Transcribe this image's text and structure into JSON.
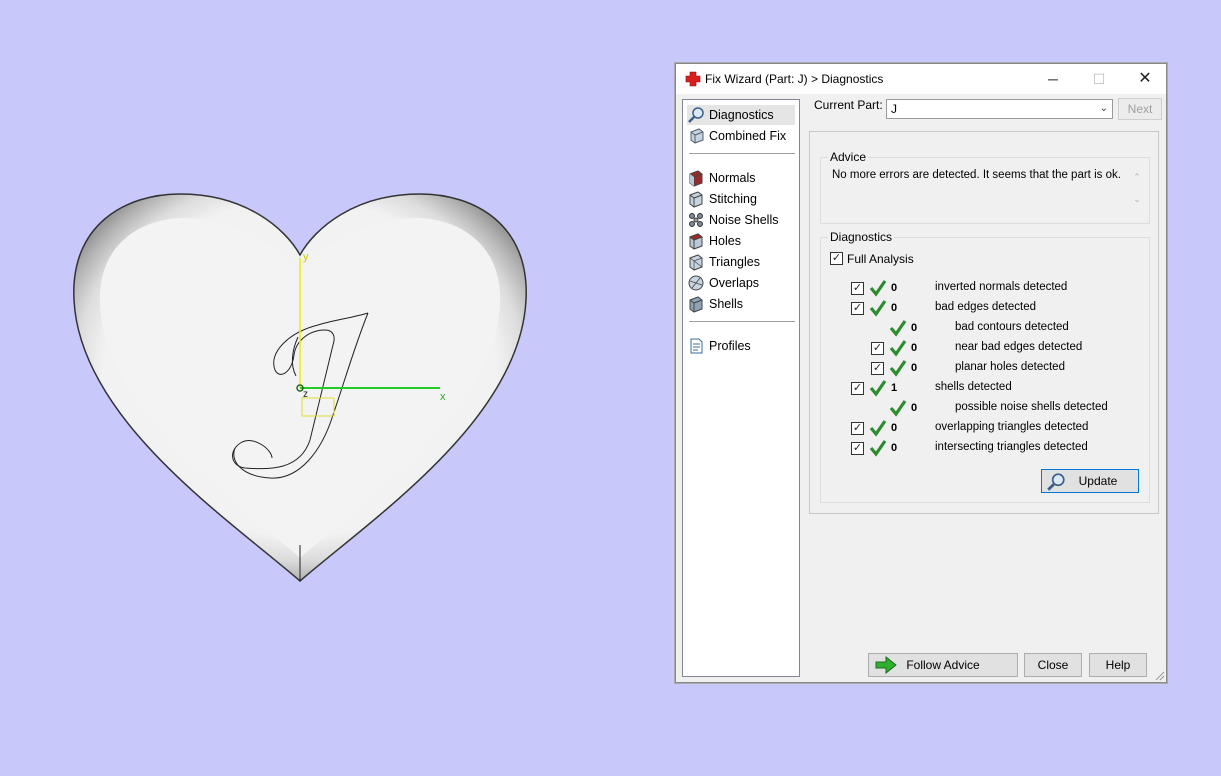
{
  "viewport": {
    "axis_x_label": "x",
    "axis_y_label": "y",
    "axis_z_label": "z",
    "axis_x_color": "#22cc22",
    "axis_y_color": "#eeee00",
    "background": "#c8c8fa"
  },
  "dialog": {
    "title": "Fix Wizard (Part: J) > Diagnostics",
    "window_controls": {
      "minimize": "─",
      "maximize": "☐",
      "close": "✕"
    },
    "sidebar": {
      "group1": [
        {
          "label": "Diagnostics",
          "icon": "magnifier-icon",
          "selected": true
        },
        {
          "label": "Combined Fix",
          "icon": "combined-fix-icon"
        }
      ],
      "group2": [
        {
          "label": "Normals",
          "icon": "normals-icon"
        },
        {
          "label": "Stitching",
          "icon": "stitching-icon"
        },
        {
          "label": "Noise Shells",
          "icon": "noise-shells-icon"
        },
        {
          "label": "Holes",
          "icon": "holes-icon"
        },
        {
          "label": "Triangles",
          "icon": "triangles-icon"
        },
        {
          "label": "Overlaps",
          "icon": "overlaps-icon"
        },
        {
          "label": "Shells",
          "icon": "shells-icon"
        }
      ],
      "group3": [
        {
          "label": "Profiles",
          "icon": "profiles-icon"
        }
      ]
    },
    "current_part_label": "Current Part:",
    "current_part_value": "J",
    "next_button": "Next",
    "advice": {
      "title": "Advice",
      "text": "No more errors are detected. It seems that the part is ok."
    },
    "diagnostics": {
      "title": "Diagnostics",
      "full_analysis_label": "Full Analysis",
      "full_analysis_checked": true,
      "rows": [
        {
          "checkbox": true,
          "count": "0",
          "text": "inverted normals detected"
        },
        {
          "checkbox": true,
          "count": "0",
          "text": "bad edges detected"
        },
        {
          "checkbox": false,
          "count": "0",
          "text": "bad contours detected"
        },
        {
          "checkbox": true,
          "count": "0",
          "text": "near bad edges detected"
        },
        {
          "checkbox": true,
          "count": "0",
          "text": "planar holes detected"
        },
        {
          "checkbox": true,
          "count": "1",
          "text": "shells detected"
        },
        {
          "checkbox": false,
          "count": "0",
          "text": "possible noise shells detected"
        },
        {
          "checkbox": true,
          "count": "0",
          "text": "overlapping triangles detected"
        },
        {
          "checkbox": true,
          "count": "0",
          "text": "intersecting triangles detected"
        }
      ],
      "update_button": "Update"
    },
    "buttons": {
      "follow_advice": "Follow Advice",
      "close": "Close",
      "help": "Help"
    },
    "colors": {
      "check_green": "#2e8b2e",
      "title_icon_red": "#d81e1e",
      "follow_arrow_green": "#2fae2f"
    }
  }
}
